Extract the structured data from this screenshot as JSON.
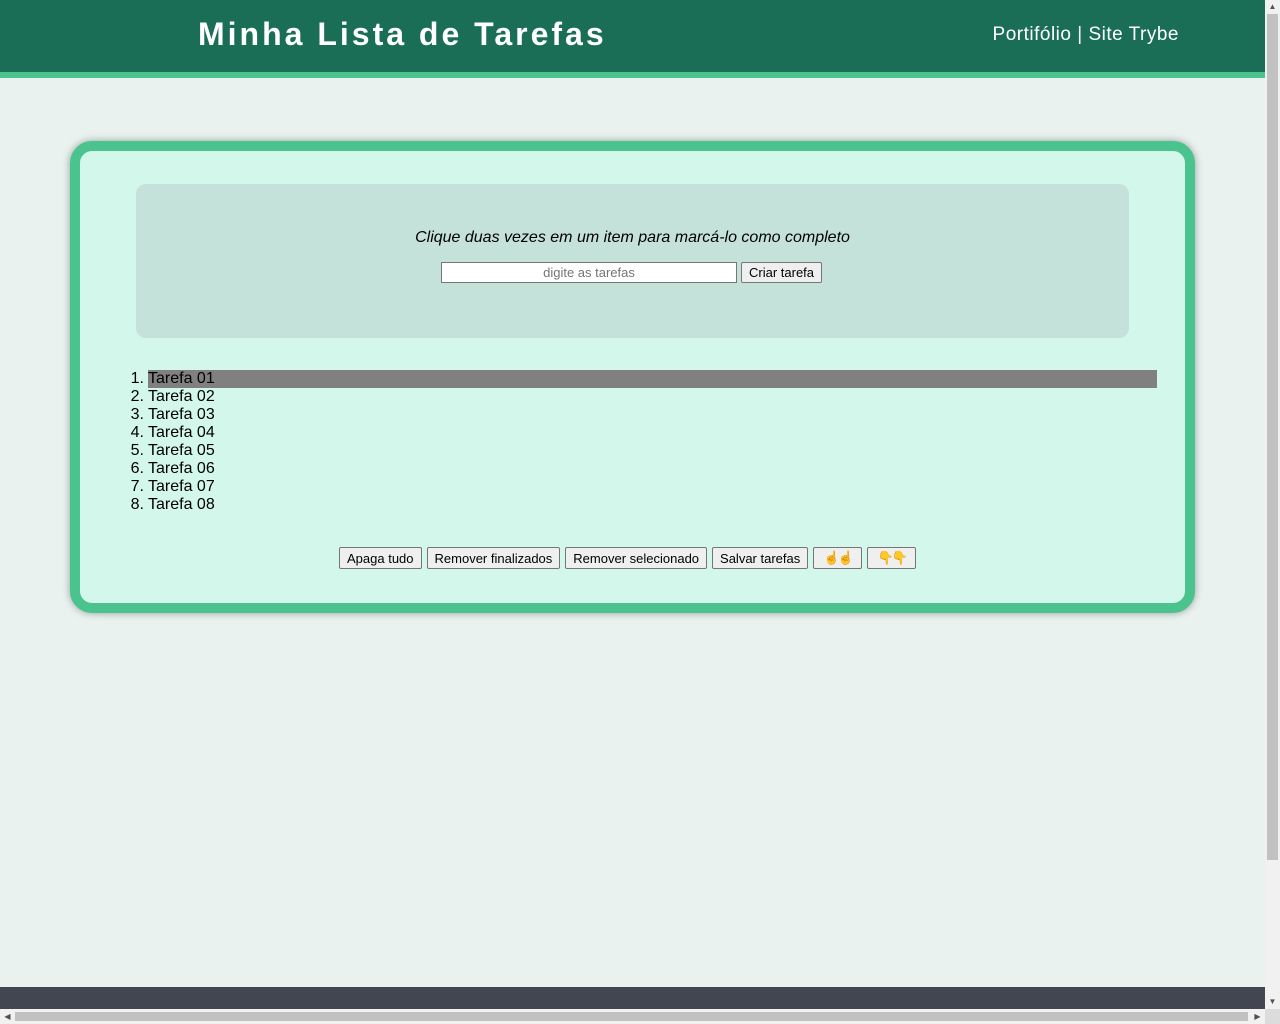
{
  "header": {
    "title": "Minha Lista de Tarefas",
    "nav_portfolio": "Portifólio",
    "nav_separator": " | ",
    "nav_trybe": "Site Trybe"
  },
  "form": {
    "instruction": "Clique duas vezes em um item para marcá-lo como completo",
    "input_placeholder": "digite as tarefas",
    "input_value": "",
    "create_label": "Criar tarefa"
  },
  "tasks": [
    {
      "num": "1.",
      "text": "Tarefa 01",
      "selected": true
    },
    {
      "num": "2.",
      "text": "Tarefa 02",
      "selected": false
    },
    {
      "num": "3.",
      "text": "Tarefa 03",
      "selected": false
    },
    {
      "num": "4.",
      "text": "Tarefa 04",
      "selected": false
    },
    {
      "num": "5.",
      "text": "Tarefa 05",
      "selected": false
    },
    {
      "num": "6.",
      "text": "Tarefa 06",
      "selected": false
    },
    {
      "num": "7.",
      "text": "Tarefa 07",
      "selected": false
    },
    {
      "num": "8.",
      "text": "Tarefa 08",
      "selected": false
    }
  ],
  "actions": {
    "clear_all": "Apaga tudo",
    "remove_finished": "Remover finalizados",
    "remove_selected": "Remover selecionado",
    "save_tasks": "Salvar tarefas",
    "move_up": "☝☝",
    "move_down": "👇👇"
  },
  "colors": {
    "header_bg": "#1a6e56",
    "accent": "#4ac38e",
    "container_bg": "#d4f7ec",
    "instruction_bg": "#c5e2da",
    "selected_bg": "#808080",
    "page_bg": "#e9f2ee",
    "footer_bg": "#424650"
  }
}
